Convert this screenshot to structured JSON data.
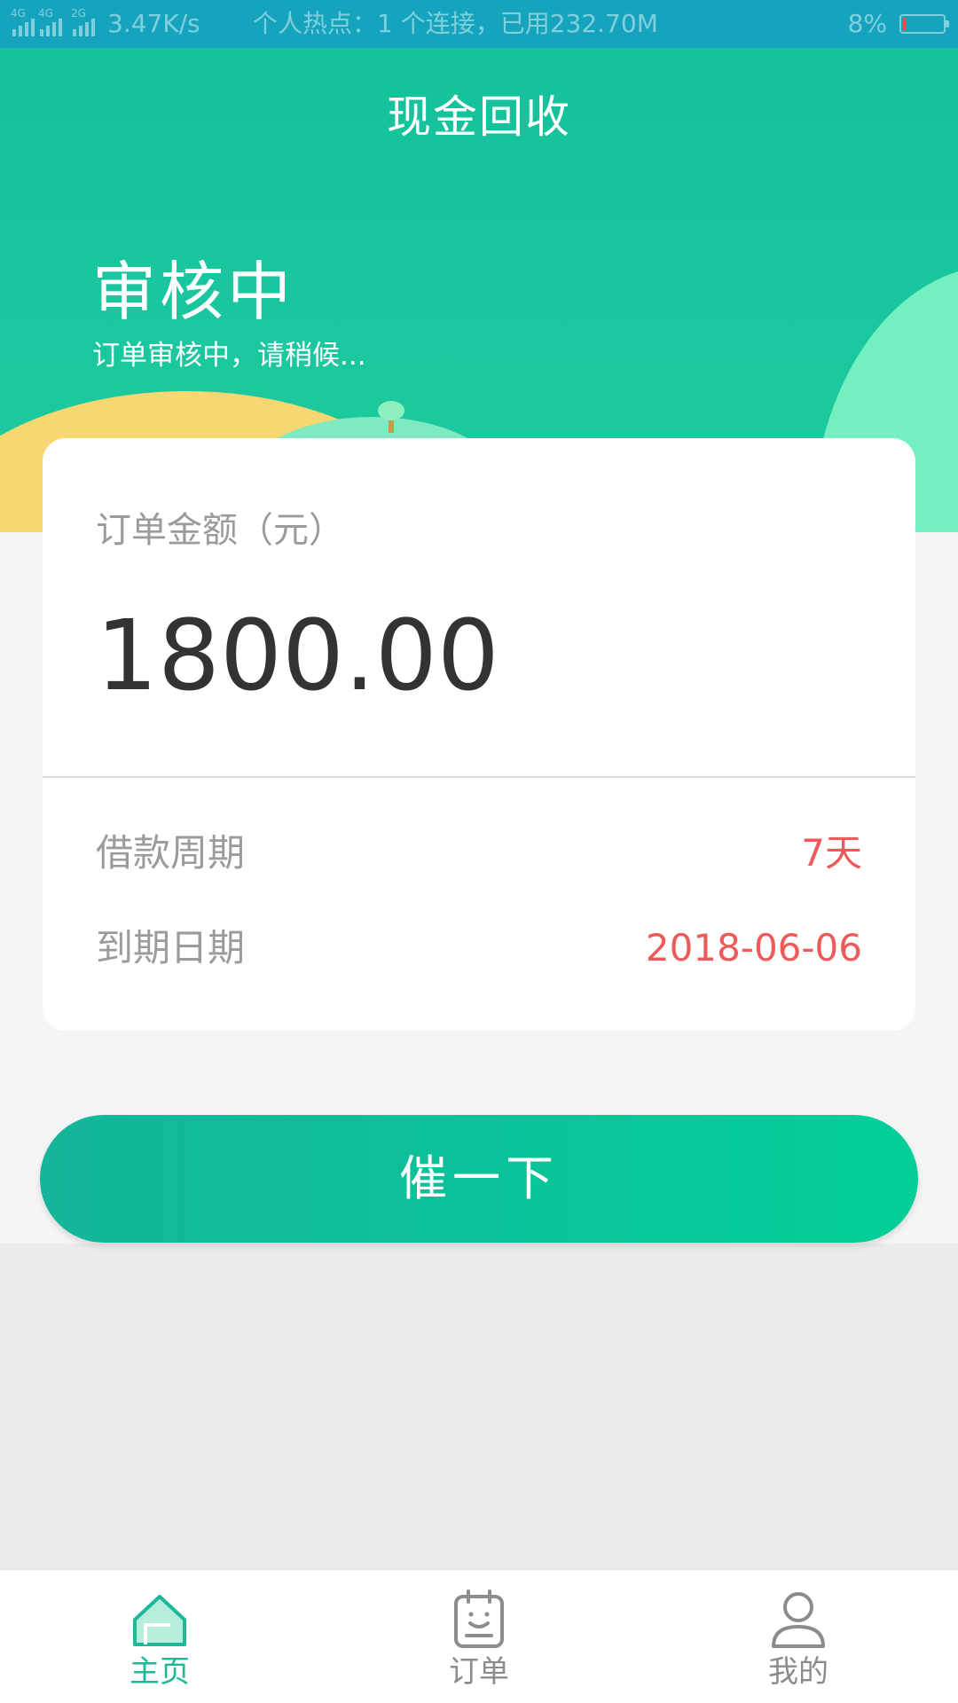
{
  "status_bar": {
    "network_left": "4G",
    "network_left_2": "4G",
    "network_right": "2G",
    "speed": "3.47K/s",
    "hotspot": "个人热点：1 个连接，已用232.70M",
    "battery": "8%",
    "battery_level_fraction": 0.08
  },
  "header": {
    "title": "现金回收",
    "status": "审核中",
    "status_subtitle": "订单审核中，请稍候..."
  },
  "order": {
    "amount_label": "订单金额（元）",
    "amount": "1800.00",
    "details": [
      {
        "label": "借款周期",
        "value": "7天"
      },
      {
        "label": "到期日期",
        "value": "2018-06-06"
      }
    ]
  },
  "action": {
    "urge_label": "催一下"
  },
  "colors": {
    "brand": "#14c19a",
    "accent_value": "#ec5a59",
    "active_tab": "#1cb898",
    "inactive_tab": "#8c8c8c"
  },
  "bottom_nav": {
    "items": [
      {
        "label": "主页",
        "icon": "home-icon",
        "active": true
      },
      {
        "label": "订单",
        "icon": "orders-icon",
        "active": false
      },
      {
        "label": "我的",
        "icon": "profile-icon",
        "active": false
      }
    ]
  }
}
